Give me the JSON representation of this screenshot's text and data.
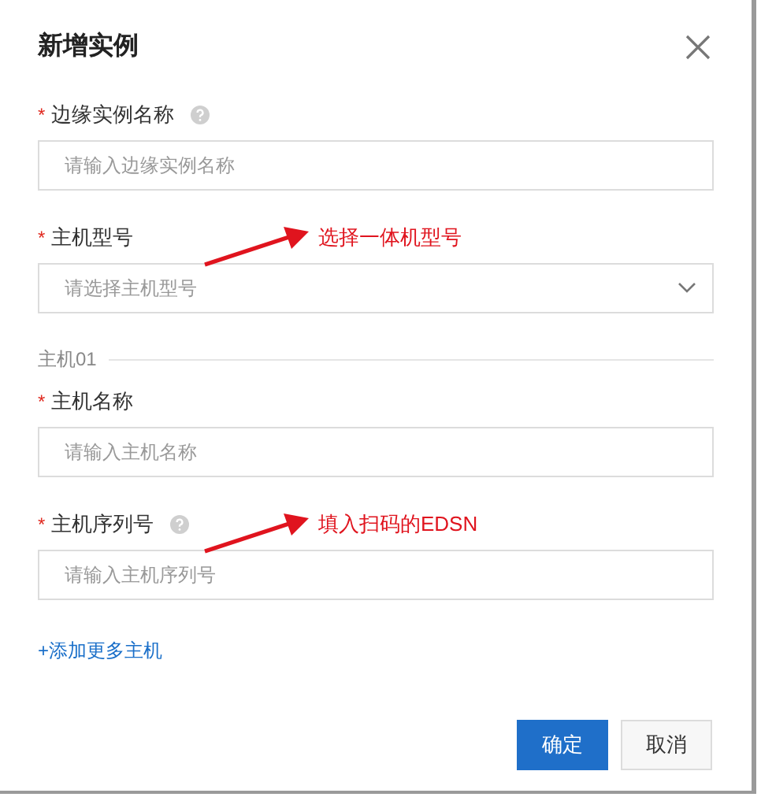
{
  "dialog": {
    "title": "新增实例"
  },
  "groups": [
    {
      "fields": [
        {
          "kind": "input",
          "label": "边缘实例名称",
          "required": "*",
          "help": true,
          "placeholder": "请输入边缘实例名称"
        },
        {
          "kind": "select",
          "label": "主机型号",
          "required": "*",
          "help": false,
          "placeholder": "请选择主机型号",
          "annotation": "选择一体机型号"
        }
      ]
    },
    {
      "section": "主机01",
      "fields": [
        {
          "kind": "input",
          "label": "主机名称",
          "required": "*",
          "help": false,
          "placeholder": "请输入主机名称"
        },
        {
          "kind": "input",
          "label": "主机序列号",
          "required": "*",
          "help": true,
          "placeholder": "请输入主机序列号",
          "annotation": "填入扫码的EDSN"
        }
      ]
    }
  ],
  "add_link": "+添加更多主机",
  "buttons": [
    {
      "kind": "primary",
      "label": "确定"
    },
    {
      "kind": "default",
      "label": "取消"
    }
  ]
}
